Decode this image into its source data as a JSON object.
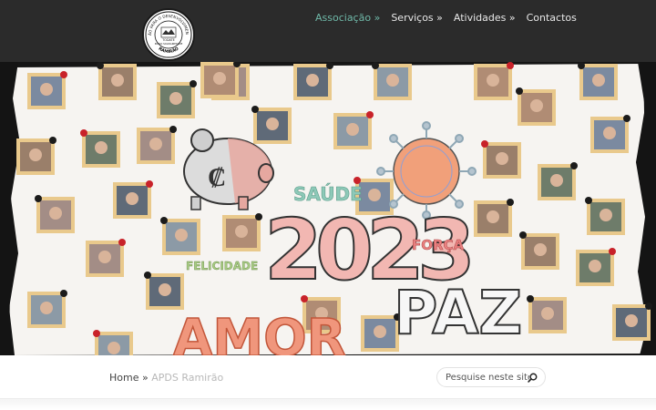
{
  "header": {
    "logo": {
      "ring_text": "ASSOCIAÇÃO PARA O DESENVOLVIMENTO SOCIAL",
      "bottom_text": "RAMIRÃO",
      "inner_text": "TODATE",
      "sub_text": "PASSO SOLIDARIEDADE"
    },
    "nav": [
      {
        "label": "Associação »",
        "active": true
      },
      {
        "label": "Serviços »",
        "active": false
      },
      {
        "label": "Atividades »",
        "active": false
      },
      {
        "label": "Contactos",
        "active": false
      }
    ],
    "active_color": "#6fb8a8"
  },
  "hero": {
    "words": {
      "saude": "SAÚDE",
      "year": "2023",
      "forca": "FORÇA",
      "felicidade": "FELICIDADE",
      "amor": "AMOR",
      "paz": "PAZ"
    }
  },
  "breadcrumb": {
    "home": "Home",
    "separator": "»",
    "current": "APDS Ramirão"
  },
  "search": {
    "placeholder": "Pesquise neste site",
    "icon": "search-icon"
  }
}
